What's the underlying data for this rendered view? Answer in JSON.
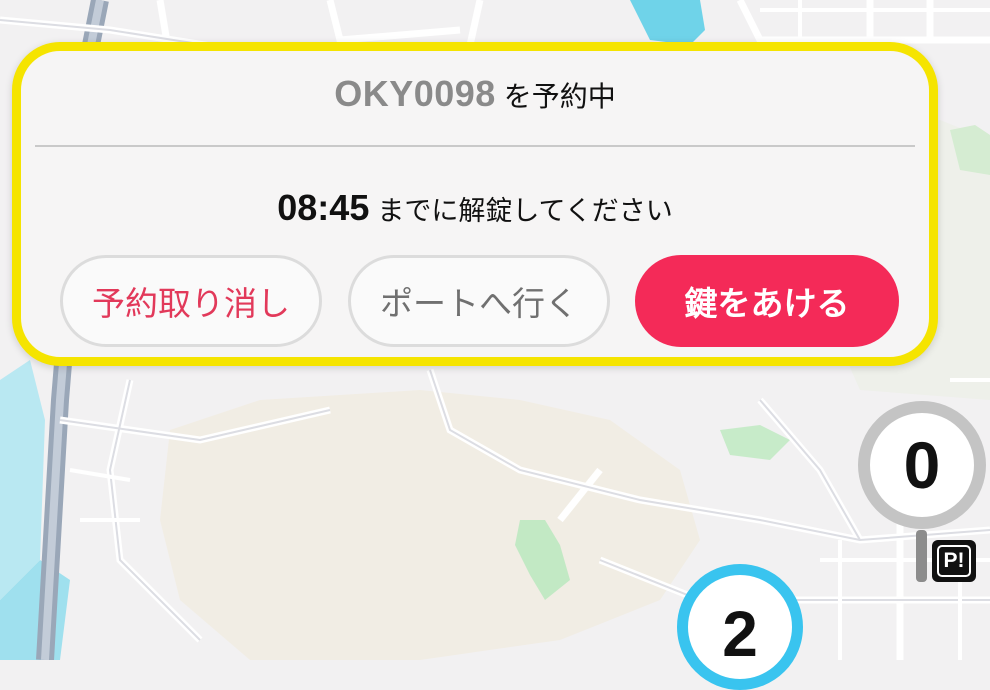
{
  "reservation": {
    "bike_id": "OKY0098",
    "status_suffix": "を予約中",
    "deadline_time": "08:45",
    "deadline_suffix": "までに解錠してください"
  },
  "actions": {
    "cancel_label": "予約取り消し",
    "go_to_port_label": "ポートへ行く",
    "unlock_label": "鍵をあける"
  },
  "map_markers": {
    "port_available_count": "0",
    "parking_icon_label": "P!",
    "nearby_port_count": "2"
  },
  "colors": {
    "card_border": "#f5e400",
    "accent_red": "#f42a58",
    "cancel_text": "#e2395a",
    "marker_gray": "#c4c4c4",
    "marker_blue": "#39c4ef"
  }
}
